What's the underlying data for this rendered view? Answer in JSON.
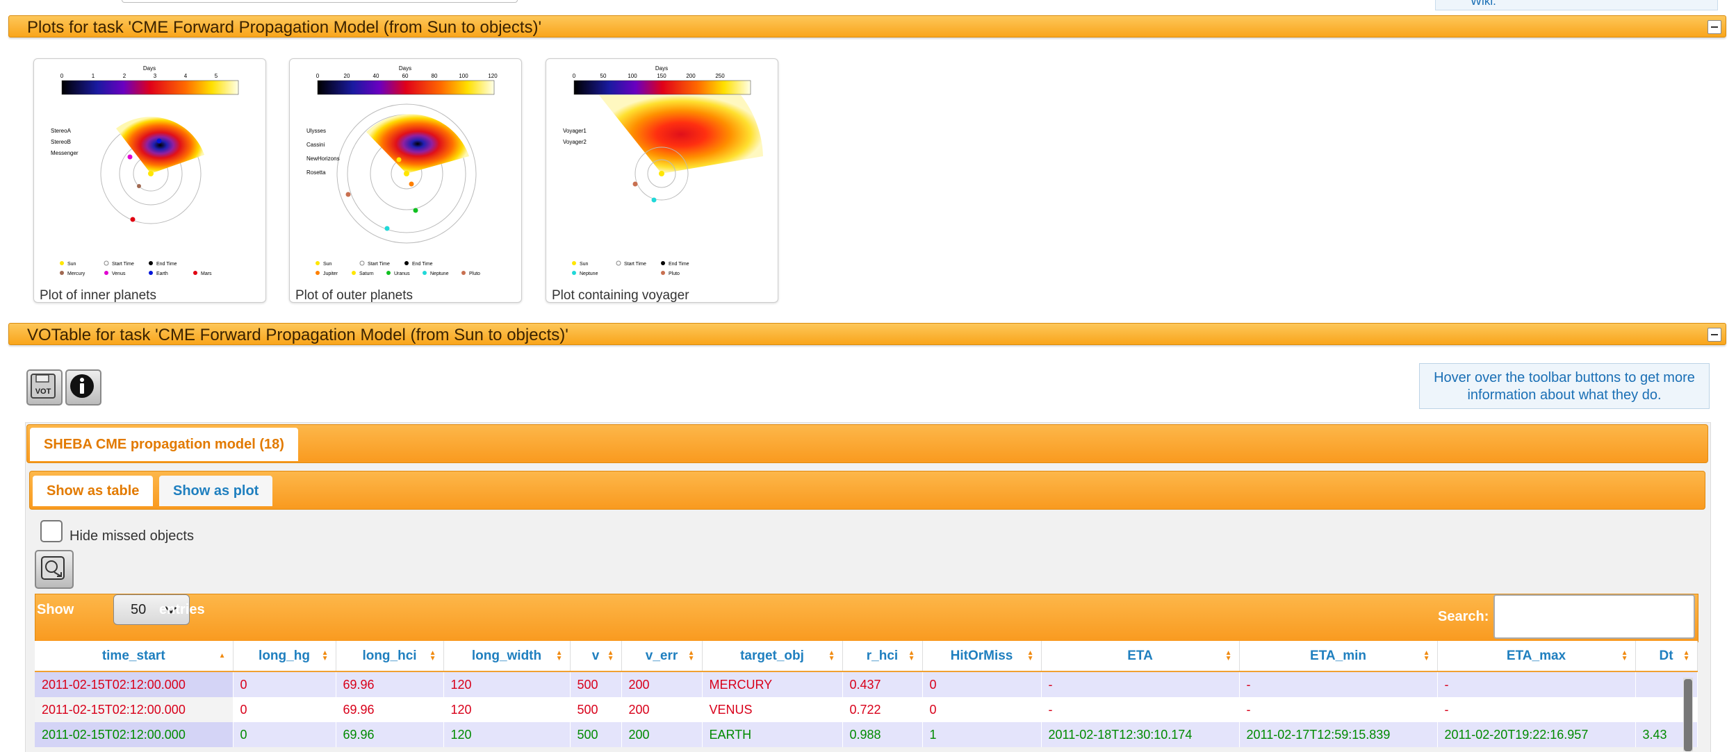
{
  "topbar": {
    "right_text": "Wiki."
  },
  "plots_section": {
    "title": "Plots for task 'CME Forward Propagation Model (from Sun to objects)'"
  },
  "plots": [
    {
      "caption": "Plot of inner planets",
      "colorbar_label": "Days",
      "colorbar_ticks": [
        "0",
        "1",
        "2",
        "3",
        "4",
        "5"
      ],
      "legend": [
        "StereoA",
        "StereoB",
        "Messenger"
      ],
      "bottom_legend": [
        [
          "Sun",
          "Start Time",
          "End Time"
        ],
        [
          "Mercury",
          "Venus",
          "Earth",
          "Mars"
        ]
      ]
    },
    {
      "caption": "Plot of outer planets",
      "colorbar_label": "Days",
      "colorbar_ticks": [
        "0",
        "20",
        "40",
        "60",
        "80",
        "100",
        "120"
      ],
      "legend": [
        "Ulysses",
        "Cassini",
        "NewHorizons",
        "Rosetta"
      ],
      "bottom_legend": [
        [
          "Sun",
          "Start Time",
          "End Time"
        ],
        [
          "Jupiter",
          "Saturn",
          "Uranus",
          "Neptune",
          "Pluto"
        ]
      ]
    },
    {
      "caption": "Plot containing voyager",
      "colorbar_label": "Days",
      "colorbar_ticks": [
        "0",
        "50",
        "100",
        "150",
        "200",
        "250"
      ],
      "legend": [
        "Voyager1",
        "Voyager2"
      ],
      "bottom_legend": [
        [
          "Sun",
          "Start Time",
          "End Time"
        ],
        [
          "Neptune",
          "Pluto"
        ]
      ]
    }
  ],
  "votable_section": {
    "title": "VOTable for task 'CME Forward Propagation Model (from Sun to objects)'"
  },
  "toolbar": {
    "vot_icon": "vot-save-icon",
    "info_icon": "info-icon",
    "hint": "Hover over the toolbar buttons to get more information about what they do."
  },
  "outer_tabs": [
    {
      "label": "SHEBA CME propagation model (18)"
    }
  ],
  "inner_tabs": [
    {
      "label": "Show as table"
    },
    {
      "label": "Show as plot"
    }
  ],
  "hide_missed_label": "Hide missed objects",
  "datatable": {
    "show_label": "Show",
    "entries_label": "entries",
    "page_size": "50",
    "search_label": "Search:",
    "columns": [
      "time_start",
      "long_hg",
      "long_hci",
      "long_width",
      "v",
      "v_err",
      "target_obj",
      "r_hci",
      "HitOrMiss",
      "ETA",
      "ETA_min",
      "ETA_max",
      "Dt"
    ],
    "rows": [
      [
        "2011-02-15T02:12:00.000",
        "0",
        "69.96",
        "120",
        "500",
        "200",
        "MERCURY",
        "0.437",
        "0",
        "-",
        "-",
        "-",
        ""
      ],
      [
        "2011-02-15T02:12:00.000",
        "0",
        "69.96",
        "120",
        "500",
        "200",
        "VENUS",
        "0.722",
        "0",
        "-",
        "-",
        "-",
        ""
      ],
      [
        "2011-02-15T02:12:00.000",
        "0",
        "69.96",
        "120",
        "500",
        "200",
        "EARTH",
        "0.988",
        "1",
        "2011-02-18T12:30:10.174",
        "2011-02-17T12:59:15.839",
        "2011-02-20T19:22:16.957",
        "3.43"
      ]
    ]
  },
  "colors": {
    "accent": "#f9a51b",
    "link": "#1f7fbf",
    "miss": "#d8001a",
    "hit": "#008a00"
  }
}
